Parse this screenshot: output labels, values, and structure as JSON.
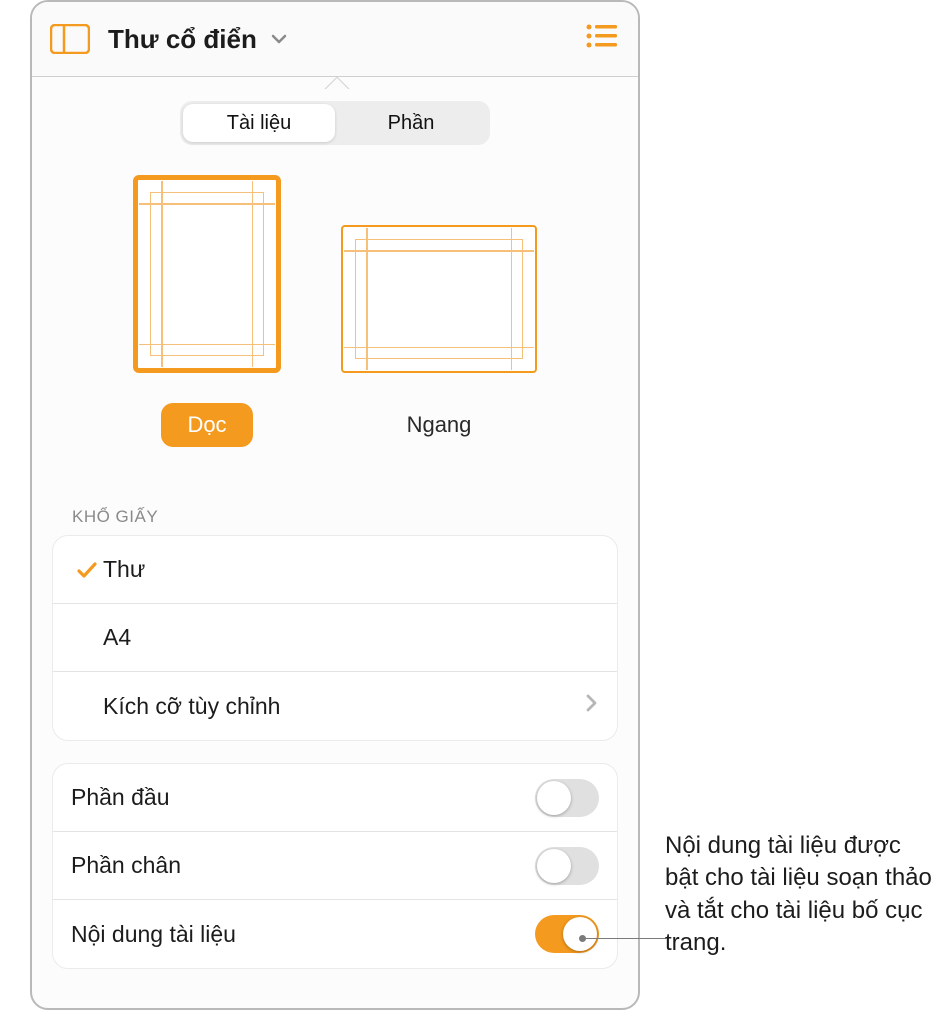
{
  "titlebar": {
    "title": "Thư cổ điển"
  },
  "tabs": {
    "items": [
      {
        "label": "Tài liệu",
        "selected": true
      },
      {
        "label": "Phần",
        "selected": false
      }
    ]
  },
  "orientation": {
    "portrait_label": "Dọc",
    "landscape_label": "Ngang"
  },
  "paper_size": {
    "header": "KHỔ GIẤY",
    "options": [
      {
        "label": "Thư",
        "selected": true
      },
      {
        "label": "A4",
        "selected": false
      }
    ],
    "custom_label": "Kích cỡ tùy chỉnh"
  },
  "toggles": {
    "items": [
      {
        "label": "Phần đầu",
        "on": false
      },
      {
        "label": "Phần chân",
        "on": false
      },
      {
        "label": "Nội dung tài liệu",
        "on": true
      }
    ]
  },
  "annotation": "Nội dung tài liệu được bật cho tài liệu soạn thảo và tắt cho tài liệu bố cục trang."
}
